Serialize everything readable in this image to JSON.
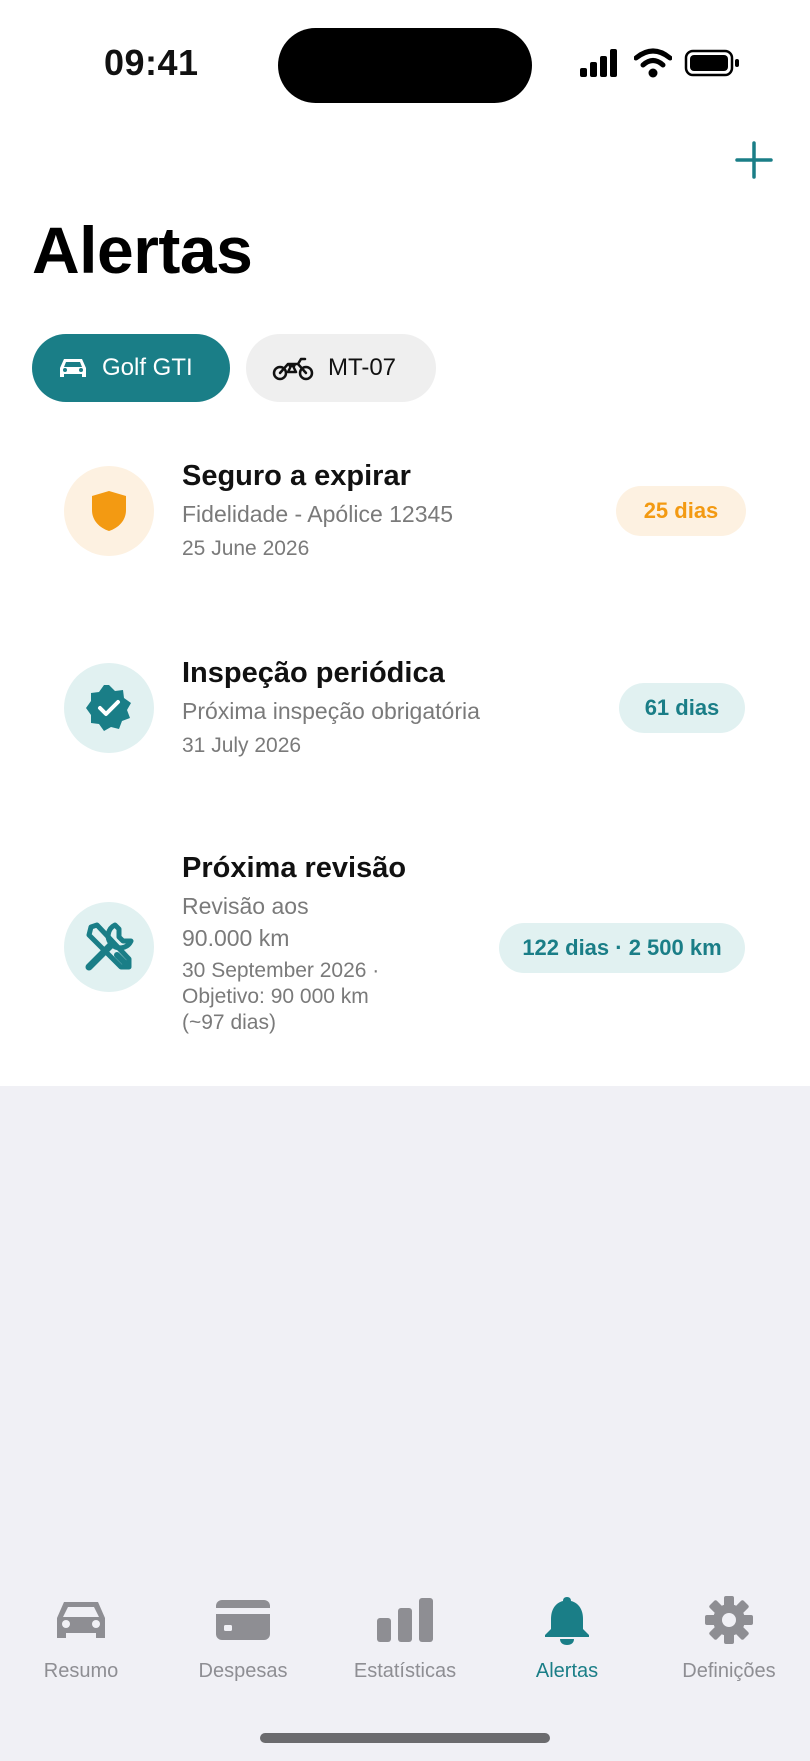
{
  "status_bar": {
    "time": "09:41"
  },
  "header": {
    "title": "Alertas",
    "add_icon": "plus-icon"
  },
  "vehicles": [
    {
      "label": "Golf GTI",
      "icon": "car-icon",
      "selected": true
    },
    {
      "label": "MT-07",
      "icon": "motorcycle-icon",
      "selected": false
    }
  ],
  "alerts": [
    {
      "title": "Seguro a expirar",
      "subtitle": "Fidelidade - Apólice 12345",
      "date": "25 June 2026",
      "badge": "25 dias",
      "icon": "shield-icon",
      "tone": "orange"
    },
    {
      "title": "Inspeção periódica",
      "subtitle": "Próxima inspeção obrigatória",
      "date": "31 July 2026",
      "badge": "61 dias",
      "icon": "verified-badge-icon",
      "tone": "teal"
    },
    {
      "title": "Próxima revisão",
      "subtitle_line1": "Revisão aos",
      "subtitle_line2": "90.000 km",
      "date_line1": "30 September 2026 ·",
      "date_line2": "Objetivo: 90 000 km",
      "date_line3": "(~97 dias)",
      "badge": "122 dias · 2 500 km",
      "icon": "tools-icon",
      "tone": "teal"
    }
  ],
  "tab_bar": {
    "tabs": [
      {
        "label": "Resumo",
        "icon": "car-icon"
      },
      {
        "label": "Despesas",
        "icon": "credit-card-icon"
      },
      {
        "label": "Estatísticas",
        "icon": "bar-chart-icon"
      },
      {
        "label": "Alertas",
        "icon": "bell-icon",
        "active": true
      },
      {
        "label": "Definições",
        "icon": "gear-icon"
      }
    ]
  },
  "colors": {
    "accent": "#1a7e87",
    "warning": "#f39a12",
    "inactive": "#8e8e93",
    "background": "#f0f0f5"
  }
}
